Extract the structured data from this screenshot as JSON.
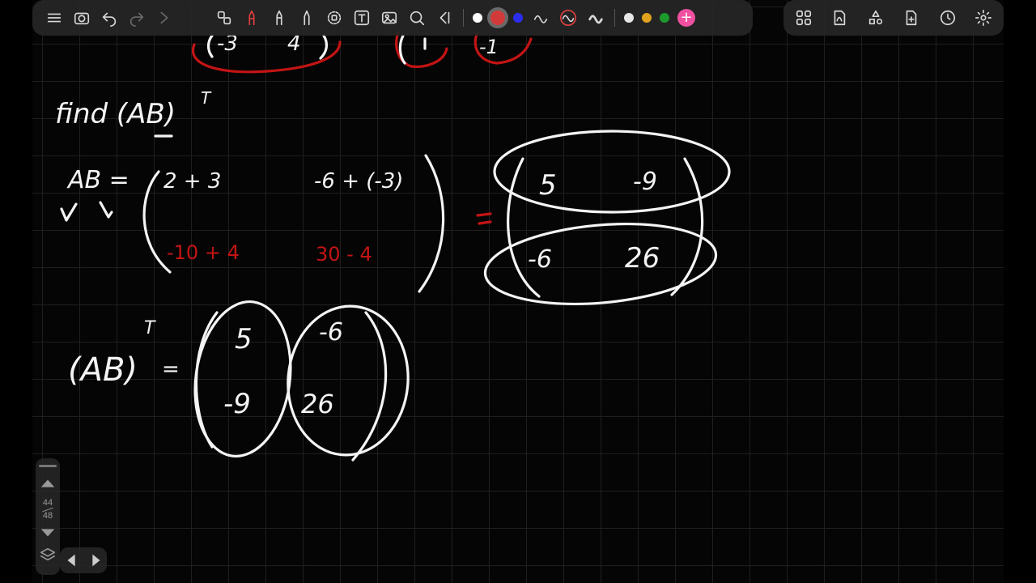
{
  "toolbar": {
    "tools": [
      {
        "name": "menu-icon"
      },
      {
        "name": "camera-icon"
      },
      {
        "name": "undo-icon"
      },
      {
        "name": "redo-icon"
      },
      {
        "name": "collapse-left-icon"
      },
      {
        "name": "shapes-icon"
      },
      {
        "name": "pen-icon"
      },
      {
        "name": "highlighter-icon"
      },
      {
        "name": "pencil-icon"
      },
      {
        "name": "lasso-icon"
      },
      {
        "name": "text-icon"
      },
      {
        "name": "image-icon"
      },
      {
        "name": "laser-icon"
      },
      {
        "name": "collapse-icon"
      }
    ],
    "colors": {
      "white": "#ffffff",
      "red": "#d23a3a",
      "blue": "#2d2df0",
      "palette": [
        "#e6e6e6",
        "#e0a21c",
        "#1c9a2c"
      ],
      "add": "#f050a0"
    },
    "right_tools": [
      {
        "name": "pages-grid-icon"
      },
      {
        "name": "pdf-icon"
      },
      {
        "name": "shapes-library-icon"
      },
      {
        "name": "add-page-icon"
      },
      {
        "name": "history-icon"
      },
      {
        "name": "settings-icon"
      }
    ]
  },
  "page_nav": {
    "current_page": "44",
    "total_pages": "48"
  },
  "notes": {
    "prompt": "find (AB)",
    "superscript": "T",
    "ab_lhs": "AB =",
    "entries": {
      "a11": "2 + 3",
      "a12": "-6 + (-3)",
      "a21": "-10 + 4",
      "a22": "30 - 4"
    },
    "result": {
      "r11": "5",
      "r12": "-9",
      "r21": "-6",
      "r22": "26"
    },
    "transpose_lhs": "(AB)",
    "transpose": {
      "t11": "5",
      "t12": "-6",
      "t21": "-9",
      "t22": "26"
    },
    "equals": "="
  }
}
